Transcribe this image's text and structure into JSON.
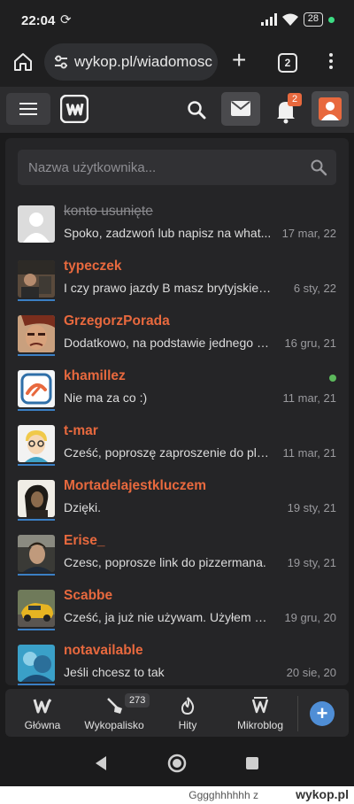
{
  "statusbar": {
    "time": "22:04",
    "battery": "28"
  },
  "browser": {
    "url": "wykop.pl/wiadomosc",
    "tab_count": "2"
  },
  "header": {
    "notifications_count": "2"
  },
  "search": {
    "placeholder": "Nazwa użytkownika..."
  },
  "conversations": [
    {
      "name": "konto usunięte",
      "snippet": "Spoko, zadzwoń lub napisz na what...",
      "date": "17 mar, 22",
      "deleted": true
    },
    {
      "name": "typeczek",
      "snippet": "I czy prawo jazdy B masz brytyjskie cz...",
      "date": "6 sty, 22"
    },
    {
      "name": "GrzegorzPorada",
      "snippet": "Dodatkowo, na podstawie jednego k...",
      "date": "16 gru, 21"
    },
    {
      "name": "khamillez",
      "snippet": "Nie ma za co :)",
      "date": "11 mar, 21",
      "online": true
    },
    {
      "name": "t-mar",
      "snippet": "Cześć, poproszę zaproszenie do plu...",
      "date": "11 mar, 21"
    },
    {
      "name": "Mortadelajestkluczem",
      "snippet": "Dzięki.",
      "date": "19 sty, 21"
    },
    {
      "name": "Erise_",
      "snippet": "Czesc, poprosze link do pizzermana.",
      "date": "19 sty, 21"
    },
    {
      "name": "Scabbe",
      "snippet": "Cześć, ja już nie używam. Użyłem pr...",
      "date": "19 gru, 20"
    },
    {
      "name": "notavailable",
      "snippet": "Jeśli chcesz to tak",
      "date": "20 sie, 20"
    }
  ],
  "bottom_nav": {
    "items": [
      {
        "label": "Główna",
        "icon": "wykop-logo-icon"
      },
      {
        "label": "Wykopalisko",
        "icon": "shovel-icon",
        "badge": "273"
      },
      {
        "label": "Hity",
        "icon": "flame-icon"
      },
      {
        "label": "Mikroblog",
        "icon": "microblog-icon"
      }
    ],
    "add_label": "+"
  },
  "footer": {
    "username": "Gggghhhhhh",
    "separator": "z",
    "site": "wykop.pl"
  },
  "colors": {
    "accent": "#e8693e",
    "link_blue": "#4f8ed6",
    "online": "#5cb85c",
    "panel": "#252527"
  }
}
